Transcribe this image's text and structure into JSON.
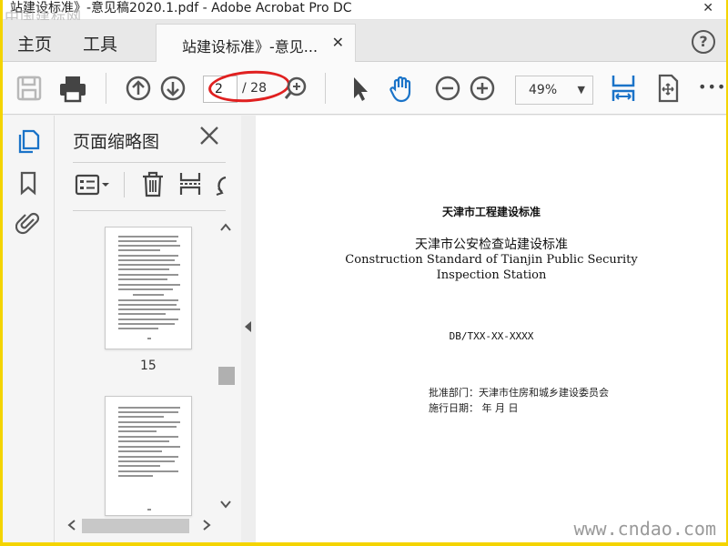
{
  "window": {
    "title": "站建设标准》-意见稿2020.1.pdf - Adobe Acrobat Pro DC",
    "close_glyph": "✕"
  },
  "watermark_top": "中国建标网",
  "menubar": {
    "home": "主页",
    "tools": "工具",
    "tab_label": "站建设标准》-意见...",
    "tab_close": "✕",
    "help": "?"
  },
  "toolbar": {
    "save_icon": "save-icon",
    "print_icon": "print-icon",
    "page_current": "2",
    "page_total": "/ 28",
    "zoom_value": "49%",
    "zoom_caret": "▼",
    "more": "•••",
    "annotation_color": "#e02020"
  },
  "panel": {
    "title": "页面缩略图",
    "thumbnail_page_label": "15"
  },
  "document": {
    "line1": "天津市工程建设标准",
    "line2": "天津市公安检查站建设标准",
    "line3": "Construction Standard of Tianjin Public Security",
    "line4": "Inspection Station",
    "code": "DB/TXX-XX-XXXX",
    "approval": "批准部门：天津市住房和城乡建设委员会",
    "date": "施行日期：   年  月  日"
  },
  "watermark_bottom": "www.cndao.com",
  "colors": {
    "frame_border": "#f4d400",
    "accent_blue": "#1a73c8"
  }
}
